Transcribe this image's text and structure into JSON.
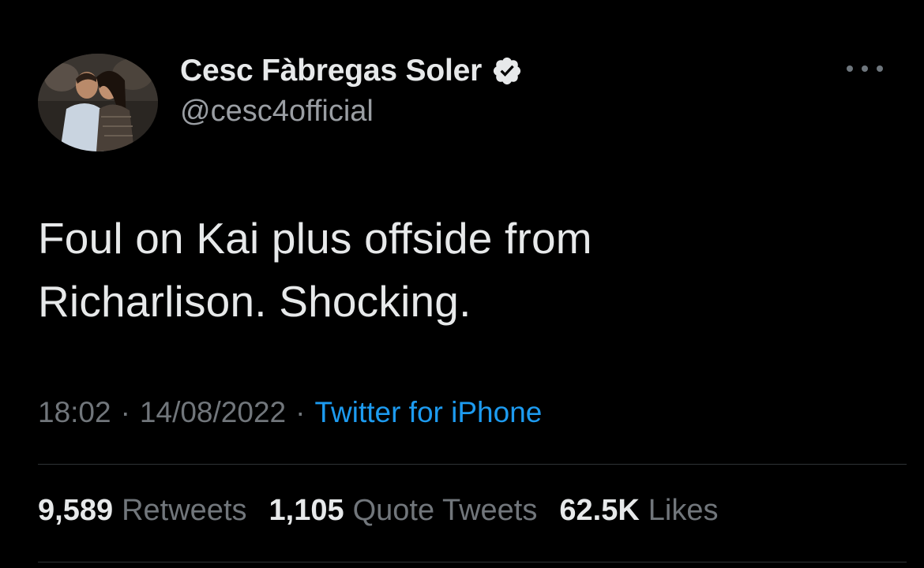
{
  "author": {
    "display_name": "Cesc Fàbregas Soler",
    "handle": "@cesc4official",
    "verified_icon": "verified-badge-icon"
  },
  "tweet": {
    "text_line1": "Foul on Kai plus offside from",
    "text_line2": "Richarlison. Shocking."
  },
  "meta": {
    "time": "18:02",
    "date": "14/08/2022",
    "separator": "·",
    "source": "Twitter for iPhone"
  },
  "stats": {
    "retweets_count": "9,589",
    "retweets_label": "Retweets",
    "quotes_count": "1,105",
    "quotes_label": "Quote Tweets",
    "likes_count": "62.5K",
    "likes_label": "Likes"
  },
  "colors": {
    "background": "#000000",
    "primary_text": "#e7e9ea",
    "secondary_text": "#71767b",
    "link": "#1d9bf0",
    "divider": "#2f3336"
  }
}
